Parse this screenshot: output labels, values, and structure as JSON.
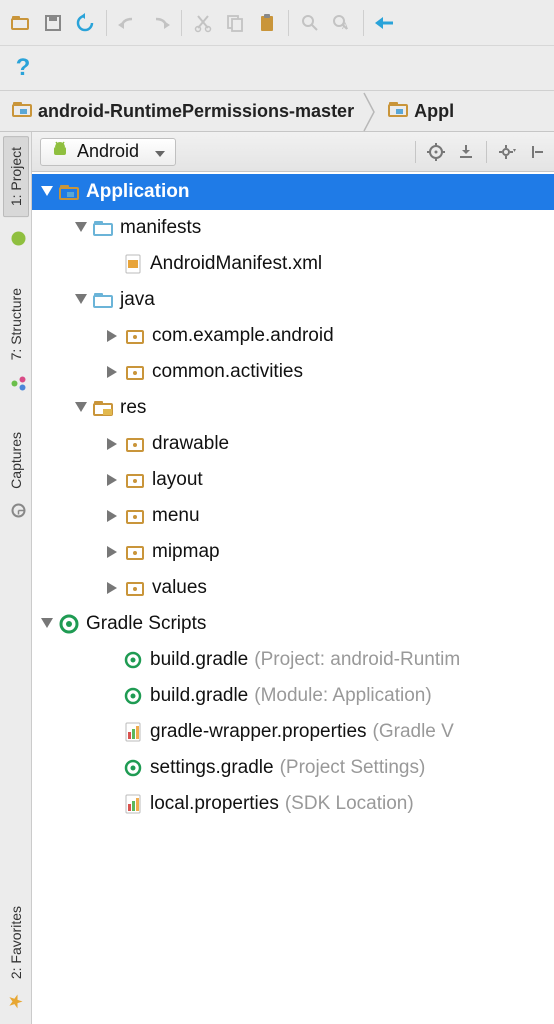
{
  "toolbar": {
    "help_glyph": "?"
  },
  "breadcrumb": {
    "root": "android-RuntimePermissions-master",
    "child": "Appl"
  },
  "panel": {
    "view_label": "Android"
  },
  "left_tabs": {
    "project": "1: Project",
    "structure": "7: Structure",
    "captures": "Captures",
    "favorites": "2: Favorites"
  },
  "tree": {
    "application": "Application",
    "manifests": "manifests",
    "manifest_file": "AndroidManifest.xml",
    "java": "java",
    "pkg_example": "com.example.android",
    "pkg_common": "common.activities",
    "res": "res",
    "drawable": "drawable",
    "layout": "layout",
    "menu": "menu",
    "mipmap": "mipmap",
    "values": "values",
    "gradle_scripts": "Gradle Scripts",
    "build_gradle": "build.gradle",
    "build_gradle_proj_suffix": "(Project: android-Runtim",
    "build_gradle_mod_suffix": "(Module: Application)",
    "wrapper_props": "gradle-wrapper.properties",
    "wrapper_props_suffix": "(Gradle V",
    "settings_gradle": "settings.gradle",
    "settings_gradle_suffix": "(Project Settings)",
    "local_props": "local.properties",
    "local_props_suffix": "(SDK Location)"
  }
}
